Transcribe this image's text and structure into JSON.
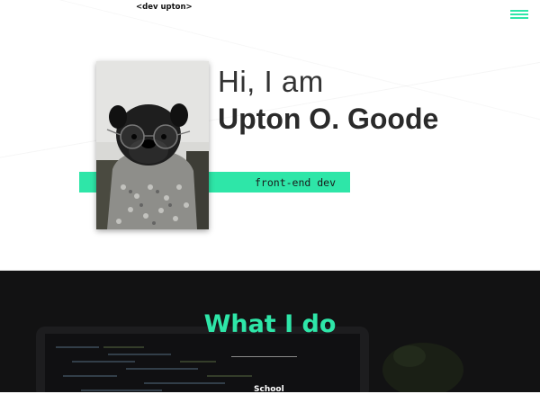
{
  "header": {
    "logo_text": "<dev upton>",
    "menu_icon": "hamburger-icon"
  },
  "hero": {
    "greeting": "Hi, I am",
    "name": "Upton O. Goode",
    "tagline": "front-end dev",
    "photo_subject": "pug-with-glasses-image"
  },
  "services": {
    "title": "What I do",
    "items": [
      {
        "label": "School"
      }
    ]
  },
  "colors": {
    "accent": "#2ee6a8",
    "dark_bg": "#0f0f10",
    "text": "#2a2a2a"
  }
}
